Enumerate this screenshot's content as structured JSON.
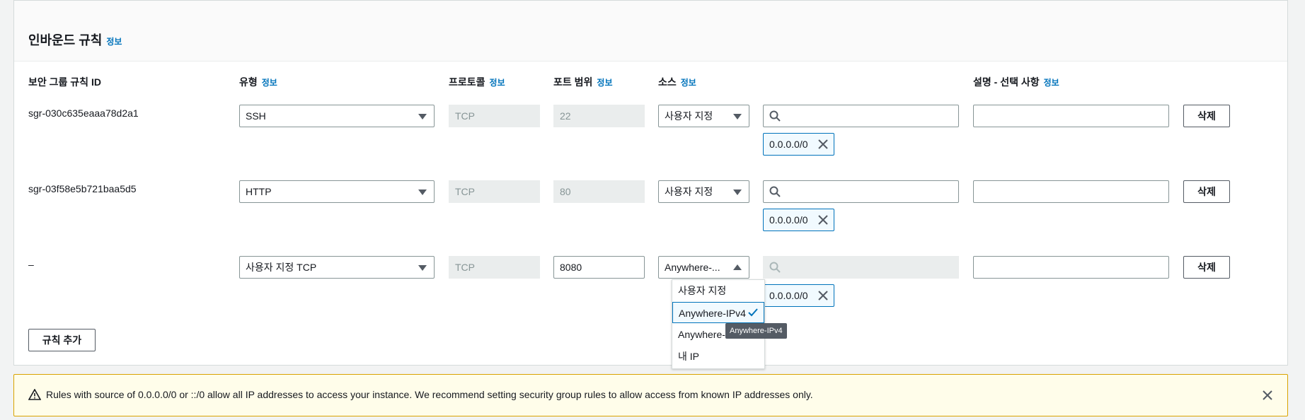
{
  "panel": {
    "title": "인바운드 규칙",
    "title_info": "정보"
  },
  "columns": {
    "rule_id": "보안 그룹 규칙 ID",
    "type": "유형",
    "type_info": "정보",
    "protocol": "프로토콜",
    "protocol_info": "정보",
    "port": "포트 범위",
    "port_info": "정보",
    "source": "소스",
    "source_info": "정보",
    "desc": "설명 - 선택 사항",
    "desc_info": "정보"
  },
  "rows": [
    {
      "id": "sgr-030c635eaaa78d2a1",
      "type": "SSH",
      "protocol": "TCP",
      "port": "22",
      "source": "사용자 지정",
      "cidr": "0.0.0.0/0",
      "search": "",
      "description": "",
      "delete": "삭제"
    },
    {
      "id": "sgr-03f58e5b721baa5d5",
      "type": "HTTP",
      "protocol": "TCP",
      "port": "80",
      "source": "사용자 지정",
      "cidr": "0.0.0.0/0",
      "search": "",
      "description": "",
      "delete": "삭제"
    },
    {
      "id": "–",
      "type": "사용자 지정 TCP",
      "protocol": "TCP",
      "port": "8080",
      "source": "Anywhere-...",
      "cidr": "0.0.0.0/0",
      "search": "",
      "description": "",
      "delete": "삭제"
    }
  ],
  "dropdown": {
    "options": [
      "사용자 지정",
      "Anywhere-IPv4",
      "Anywhere-IPv6",
      "내 IP"
    ],
    "selected": "Anywhere-IPv4",
    "visible_partial_option": "Anywhere-"
  },
  "tooltip": "Anywhere-IPv4",
  "add_rule": "규칙 추가",
  "alert": {
    "text": "Rules with source of 0.0.0.0/0 or ::/0 allow all IP addresses to access your instance. We recommend setting security group rules to allow access from known IP addresses only."
  },
  "colors": {
    "link": "#0073bb",
    "border": "#879596",
    "alert_bg": "#fffdea",
    "alert_border": "#d9a300"
  },
  "icons": [
    "search-icon",
    "close-icon",
    "caret-down-icon",
    "caret-up-icon",
    "check-icon",
    "warning-icon"
  ]
}
